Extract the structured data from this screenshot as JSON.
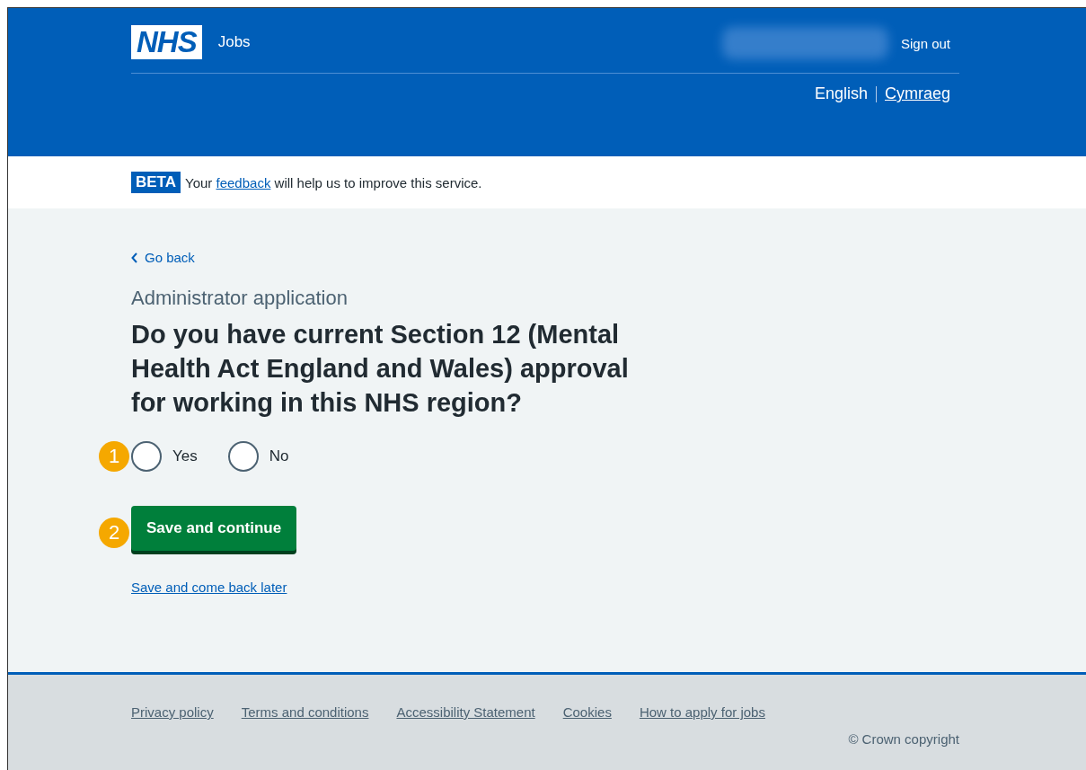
{
  "header": {
    "logo": "NHS",
    "service": "Jobs",
    "account": {
      "redacted": true
    },
    "sign_out": "Sign out",
    "languages": [
      {
        "label": "English",
        "selected": true
      },
      {
        "label": "Cymraeg",
        "selected": false
      }
    ]
  },
  "phase_banner": {
    "tag": "BETA",
    "before": "Your",
    "link": "feedback",
    "after": "will help us to improve this service."
  },
  "back_link": "Go back",
  "caption": "Administrator application",
  "question": "Do you have current Section 12 (Mental Health Act England and Wales) approval for working in this NHS region?",
  "callouts": [
    "1",
    "2"
  ],
  "options": [
    {
      "label": "Yes",
      "selected": false
    },
    {
      "label": "No",
      "selected": false
    }
  ],
  "primary_button": "Save and continue",
  "secondary_link": "Save and come back later",
  "footer": {
    "links": [
      "Privacy policy",
      "Terms and conditions",
      "Accessibility Statement",
      "Cookies",
      "How to apply for jobs"
    ],
    "copyright": "© Crown copyright"
  }
}
